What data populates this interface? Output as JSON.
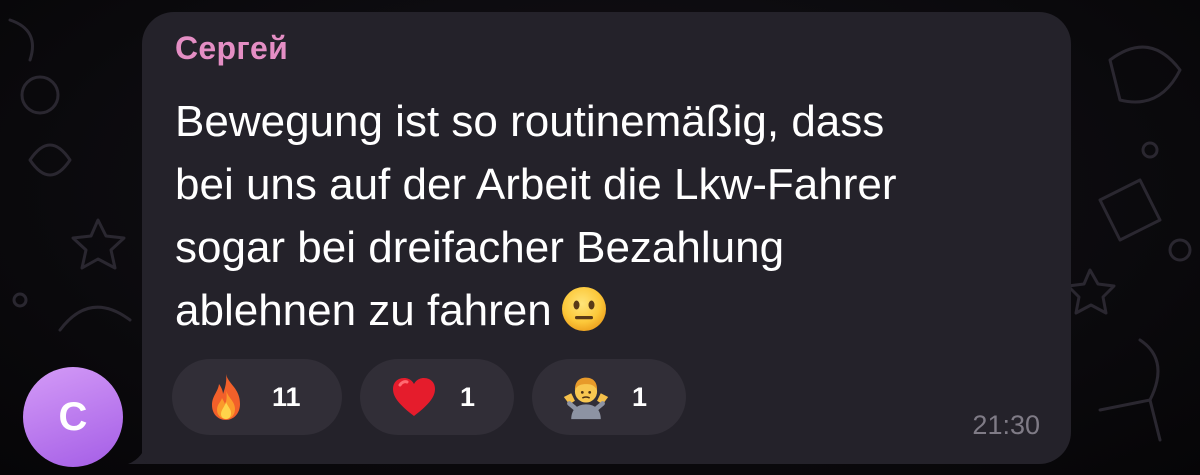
{
  "sender": {
    "name": "Сергей",
    "color": "#e48ec4",
    "avatar_letter": "C",
    "avatar_colors": [
      "#d49bf7",
      "#a45de6"
    ]
  },
  "message": {
    "lines": [
      "Bewegung ist so routinemäßig, dass",
      "bei uns auf der Arbeit die Lkw-Fahrer",
      "sogar bei dreifacher Bezahlung",
      "ablehnen zu fahren"
    ],
    "trailing_emoji": "neutral-face-emoji"
  },
  "reactions": [
    {
      "emoji": "fire-emoji",
      "count": "11"
    },
    {
      "emoji": "red-heart-emoji",
      "count": "1"
    },
    {
      "emoji": "person-shrugging-emoji",
      "count": "1"
    }
  ],
  "timestamp": "21:30",
  "colors": {
    "bubble": "#24222a",
    "reaction_pill": "#312e37",
    "background": "#0b0a0d"
  }
}
